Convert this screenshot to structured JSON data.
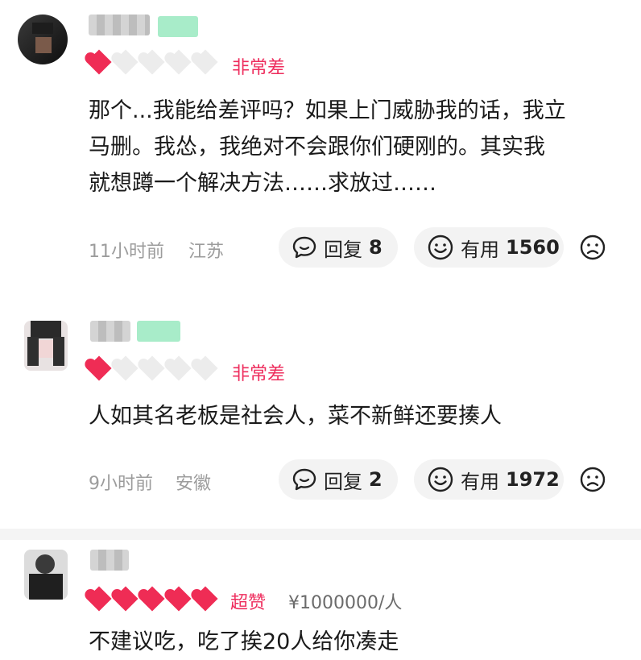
{
  "reviews": [
    {
      "rating_label": "非常差",
      "hearts_filled": 1,
      "hearts_total": 5,
      "comment_lines": [
        "那个...我能给差评吗？如果上门威胁我的话，我立",
        "马删。我怂，我绝对不会跟你们硬刚的。其实我",
        "就想蹲一个解决方法……求放过……"
      ],
      "time": "11小时前",
      "location": "江苏",
      "reply_label": "回复",
      "reply_count": "8",
      "useful_label": "有用",
      "useful_count": "1560"
    },
    {
      "rating_label": "非常差",
      "hearts_filled": 1,
      "hearts_total": 5,
      "comment_lines": [
        "人如其名老板是社会人，菜不新鲜还要揍人"
      ],
      "time": "9小时前",
      "location": "安徽",
      "reply_label": "回复",
      "reply_count": "2",
      "useful_label": "有用",
      "useful_count": "1972"
    },
    {
      "rating_label": "超赞",
      "hearts_filled": 5,
      "hearts_total": 5,
      "price": "¥1000000/人",
      "comment_lines": [
        "不建议吃，吃了挨20人给你凑走"
      ]
    }
  ],
  "colors": {
    "heart_filled": "#ef2c55",
    "heart_empty": "#e9e9e9",
    "rating_text": "#ee2d5d",
    "level_badge": "#a8ecc9"
  },
  "icons": {
    "reply": "speech-bubble-icon",
    "useful": "smile-icon",
    "dislike": "frown-icon"
  }
}
